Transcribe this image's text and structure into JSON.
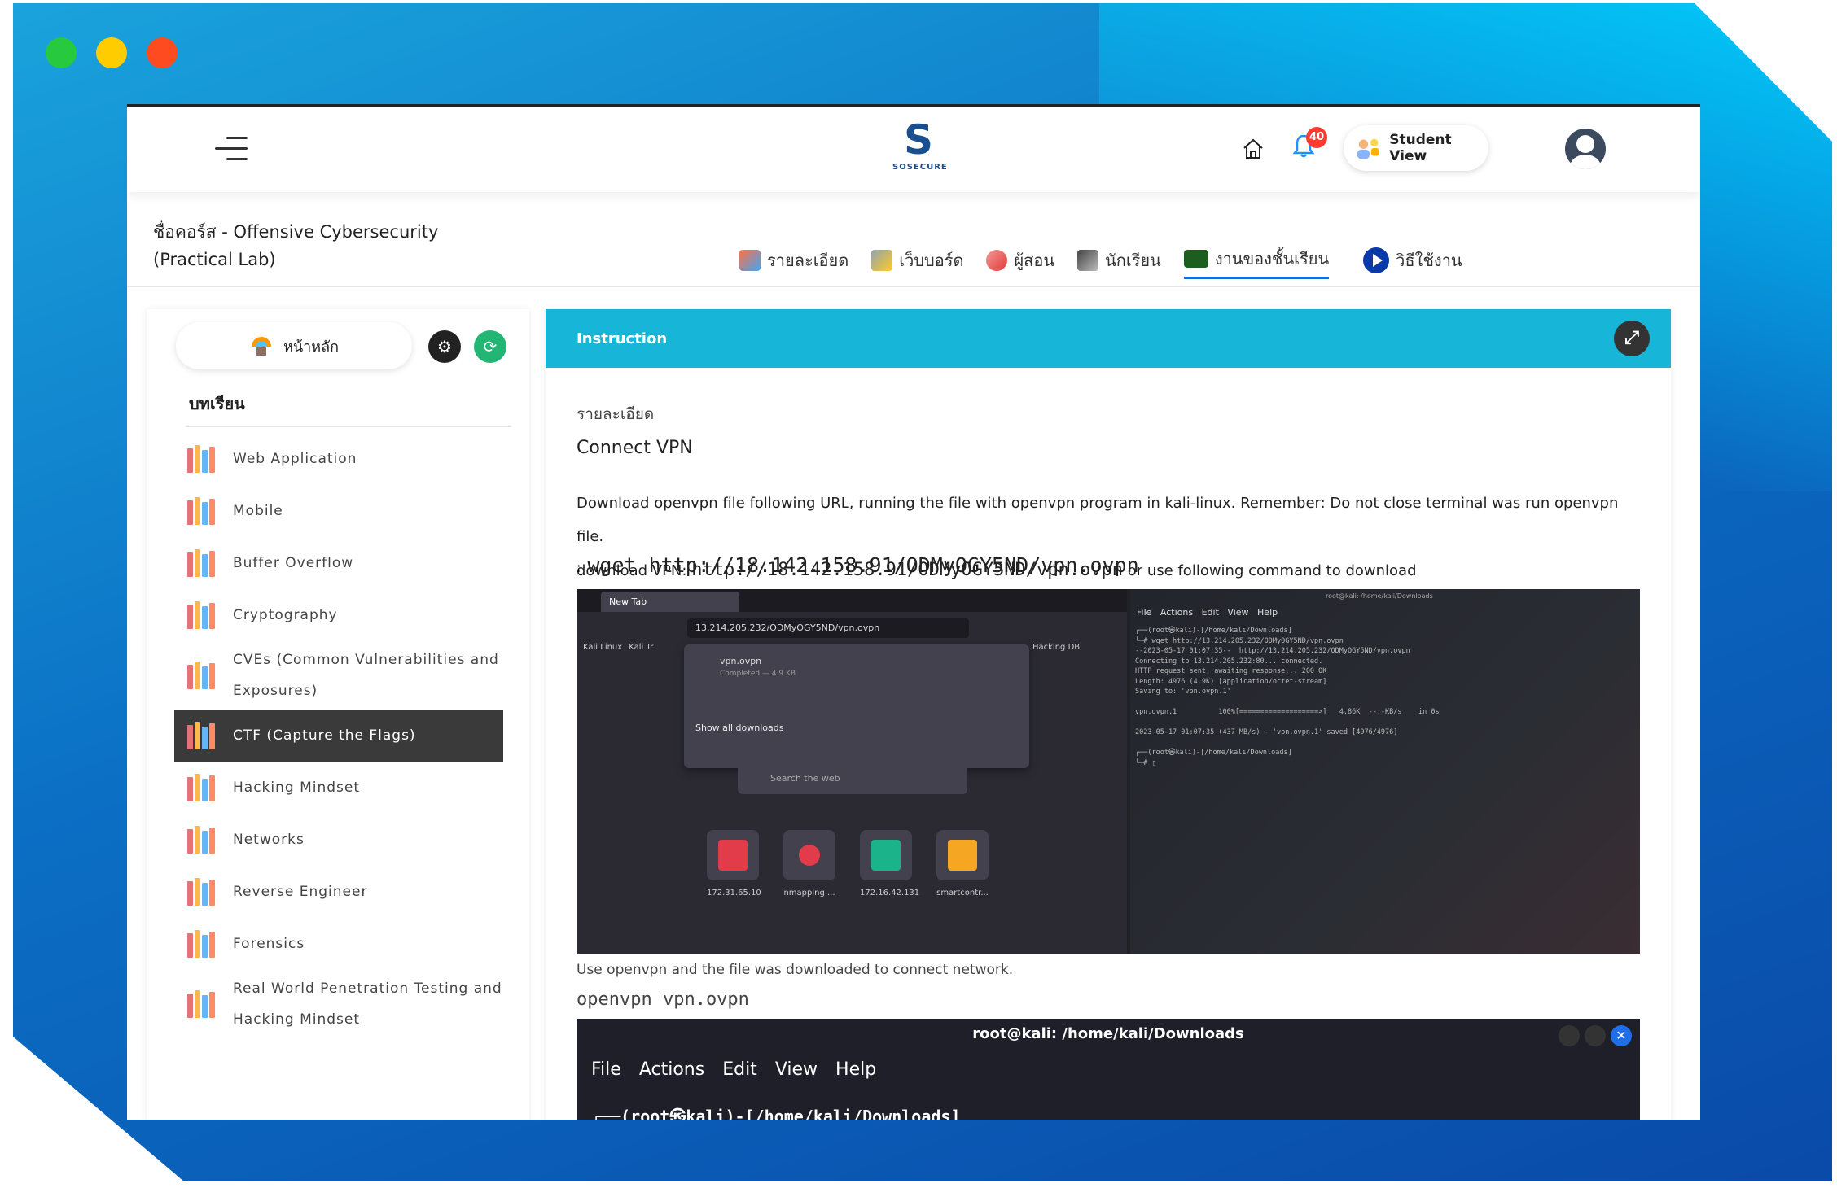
{
  "topbar": {
    "logo_letter": "S",
    "logo_text": "SOSECURE",
    "notification_count": "40",
    "student_view_label": "Student View"
  },
  "course": {
    "title": "ชื่อคอร์ส - Offensive Cybersecurity (Practical Lab)"
  },
  "tabs": [
    {
      "label": "รายละเอียด"
    },
    {
      "label": "เว็บบอร์ด"
    },
    {
      "label": "ผู้สอน"
    },
    {
      "label": "นักเรียน"
    },
    {
      "label": "งานของชั้นเรียน"
    },
    {
      "label": "วิธีใช้งาน"
    }
  ],
  "sidebar": {
    "home_label": "หน้าหลัก",
    "lessons_heading": "บทเรียน",
    "lessons": [
      {
        "label": "Web Application"
      },
      {
        "label": "Mobile"
      },
      {
        "label": "Buffer Overflow"
      },
      {
        "label": "Cryptography"
      },
      {
        "label": "CVEs (Common Vulnerabilities and Exposures)"
      },
      {
        "label": "CTF (Capture the Flags)"
      },
      {
        "label": "Hacking Mindset"
      },
      {
        "label": "Networks"
      },
      {
        "label": "Reverse Engineer"
      },
      {
        "label": "Forensics"
      },
      {
        "label": "Real World Penetration Testing and Hacking Mindset"
      }
    ]
  },
  "panel": {
    "header": "Instruction",
    "label": "รายละเอียด",
    "title": "Connect VPN",
    "desc_line1": "Download openvpn file following URL, running the file with openvpn program in kali-linux. Remember: Do not close terminal was run openvpn file.",
    "desc_prefix": "download VPN:",
    "vpn_url": "http://18.142.158.91/ODMyOGY5ND/vpn.ovpn",
    "desc_suffix": "or use following command to download",
    "cmd_prefix": ":",
    "wget_cmd": "wget http://18.142.158.91/ODMyOGY5ND/vpn.ovpn",
    "caption": "Use openvpn and the file was downloaded to connect network.",
    "openvpn_cmd": "openvpn vpn.ovpn"
  },
  "screenshot1": {
    "tab_label": "New Tab",
    "url": "13.214.205.232/ODMyOGY5ND/vpn.ovpn",
    "bookmarks": [
      "Kali Linux",
      "Kali Tr",
      "Hacking DB"
    ],
    "download_name": "vpn.ovpn",
    "download_status": "Completed — 4.9 KB",
    "show_all": "Show all downloads",
    "search_placeholder": "Search the web",
    "tiles": [
      {
        "label": "172.31.65.10"
      },
      {
        "label": "nmapping...."
      },
      {
        "label": "172.16.42.131"
      },
      {
        "label": "smartcontr..."
      }
    ],
    "terminal_title": "root@kali: /home/kali/Downloads",
    "terminal_menu": [
      "File",
      "Actions",
      "Edit",
      "View",
      "Help"
    ],
    "terminal_text": "┌──(root㉿kali)-[/home/kali/Downloads]\n└─# wget http://13.214.205.232/ODMyOGY5ND/vpn.ovpn\n--2023-05-17 01:07:35--  http://13.214.205.232/ODMyOGY5ND/vpn.ovpn\nConnecting to 13.214.205.232:80... connected.\nHTTP request sent, awaiting response... 200 OK\nLength: 4976 (4.9K) [application/octet-stream]\nSaving to: 'vpn.ovpn.1'\n\nvpn.ovpn.1          100%[===================>]   4.86K  --.-KB/s    in 0s\n\n2023-05-17 01:07:35 (437 MB/s) - 'vpn.ovpn.1' saved [4976/4976]\n\n┌──(root㉿kali)-[/home/kali/Downloads]\n└─# ▯"
  },
  "screenshot2": {
    "title": "root@kali: /home/kali/Downloads",
    "menu": [
      "File",
      "Actions",
      "Edit",
      "View",
      "Help"
    ],
    "prompt": "┌──(root㉿kali)-[/home/kali/Downloads]"
  },
  "colors": {
    "accent": "#17b6d9",
    "active_lesson": "#3a3a3a",
    "frame_blue": "#0b6fc4"
  }
}
